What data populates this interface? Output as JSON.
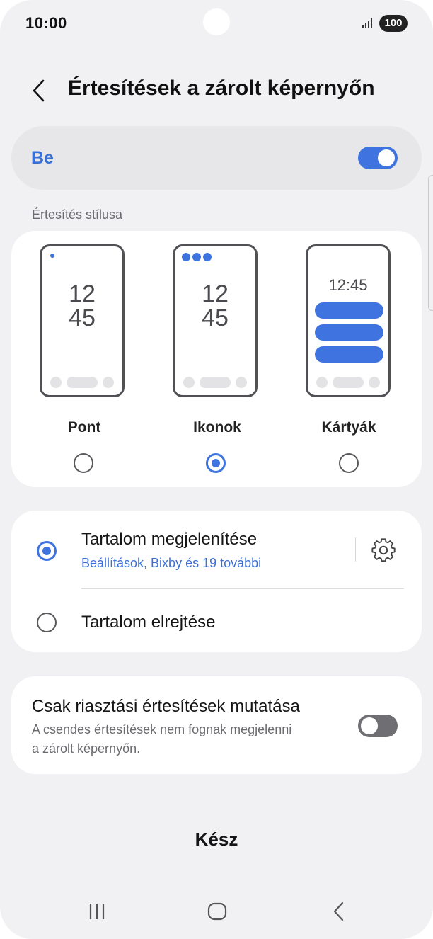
{
  "status_bar": {
    "time": "10:00",
    "battery": "100",
    "signal_icon": "signal-bars-icon"
  },
  "header": {
    "title": "Értesítések a zárolt képernyőn",
    "back_icon": "back-chevron-icon"
  },
  "master": {
    "label": "Be",
    "enabled": true
  },
  "style_section": {
    "label": "Értesítés stílusa",
    "options": [
      {
        "label": "Pont",
        "clock": [
          "12",
          "45"
        ],
        "selected": false
      },
      {
        "label": "Ikonok",
        "clock": [
          "12",
          "45"
        ],
        "selected": true
      },
      {
        "label": "Kártyák",
        "clock": "12:45",
        "selected": false
      }
    ]
  },
  "content_section": {
    "show": {
      "title": "Tartalom megjelenítése",
      "subtitle": "Beállítások, Bixby és 19 további",
      "selected": true,
      "settings_icon": "gear-icon"
    },
    "hide": {
      "title": "Tartalom elrejtése",
      "selected": false
    }
  },
  "alerts_only": {
    "title": "Csak riasztási értesítések mutatása",
    "description": "A csendes értesítések nem fognak megjelenni a zárolt képernyőn.",
    "enabled": false
  },
  "done_label": "Kész",
  "nav_bar": {
    "icons": [
      "recent-apps-icon",
      "home-icon",
      "back-icon"
    ]
  },
  "colors": {
    "accent": "#3f74e0",
    "background": "#f1f1f3"
  }
}
